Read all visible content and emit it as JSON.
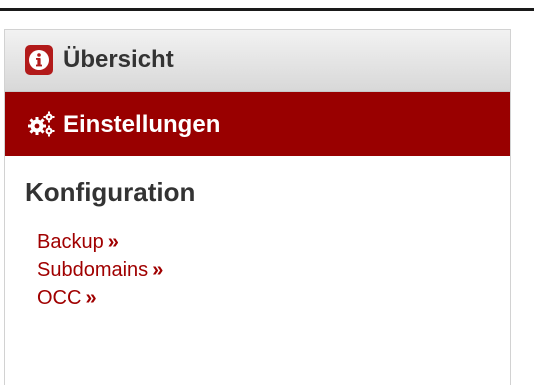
{
  "nav": {
    "overview_label": "Übersicht",
    "settings_label": "Einstellungen"
  },
  "section": {
    "heading": "Konfiguration",
    "links": [
      {
        "label": "Backup",
        "arrow": "»"
      },
      {
        "label": "Subdomains",
        "arrow": "»"
      },
      {
        "label": "OCC",
        "arrow": "»"
      }
    ]
  },
  "icons": {
    "overview": "info-icon",
    "settings": "gears-icon"
  },
  "colors": {
    "accent": "#990000",
    "badge": "#b21a1a",
    "link": "#a00000",
    "heading": "#333333",
    "nav_bg": "#e4e4e4"
  }
}
